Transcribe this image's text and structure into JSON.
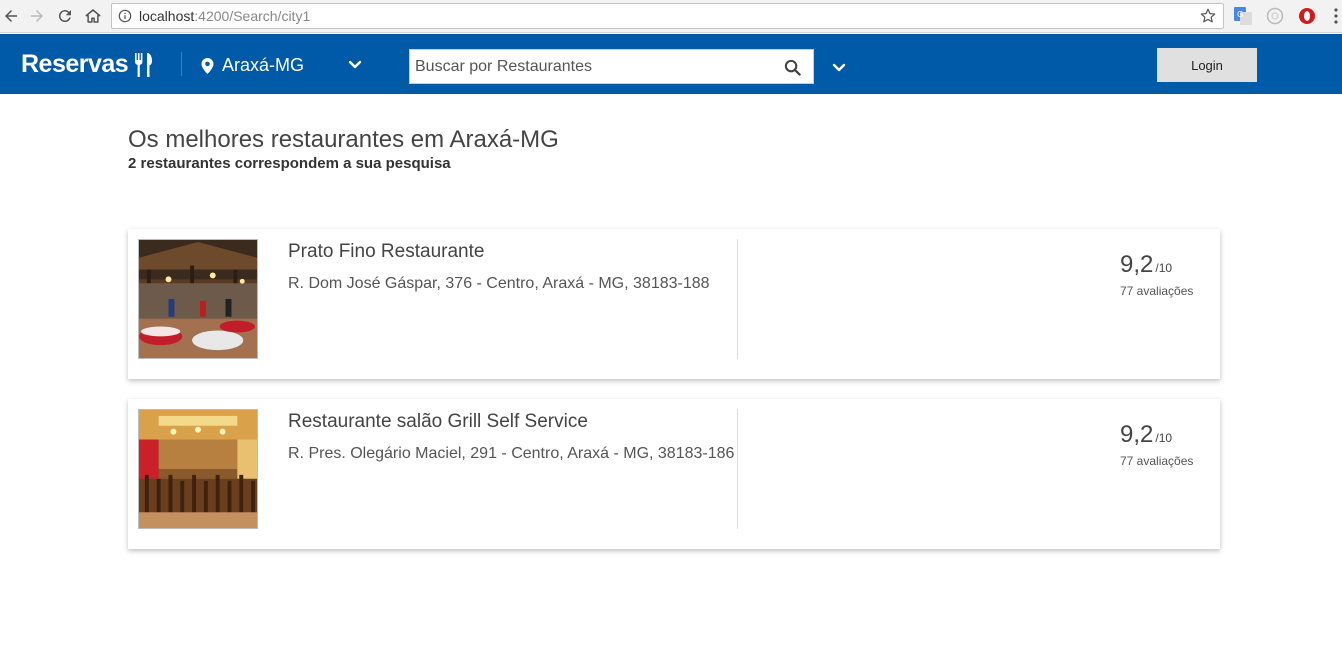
{
  "browser": {
    "url_host": "localhost",
    "url_path": ":4200/Search/city1"
  },
  "header": {
    "brand": "Reservas",
    "city": "Araxá-MG",
    "search_placeholder": "Buscar por Restaurantes",
    "login_label": "Login",
    "colors": {
      "primary": "#005aa8"
    }
  },
  "main": {
    "title": "Os melhores restaurantes em Araxá-MG",
    "results_count": "2 restaurantes correspondem a sua pesquisa",
    "restaurants": [
      {
        "name": "Prato Fino Restaurante",
        "address": "R. Dom José Gáspar, 376 - Centro, Araxá - MG, 38183-188",
        "score": "9,2",
        "scale": "/10",
        "reviews": "77 avaliações"
      },
      {
        "name": "Restaurante salão Grill Self Service",
        "address": "R. Pres. Olegário Maciel, 291 - Centro, Araxá - MG, 38183-186",
        "score": "9,2",
        "scale": "/10",
        "reviews": "77 avaliações"
      }
    ]
  }
}
